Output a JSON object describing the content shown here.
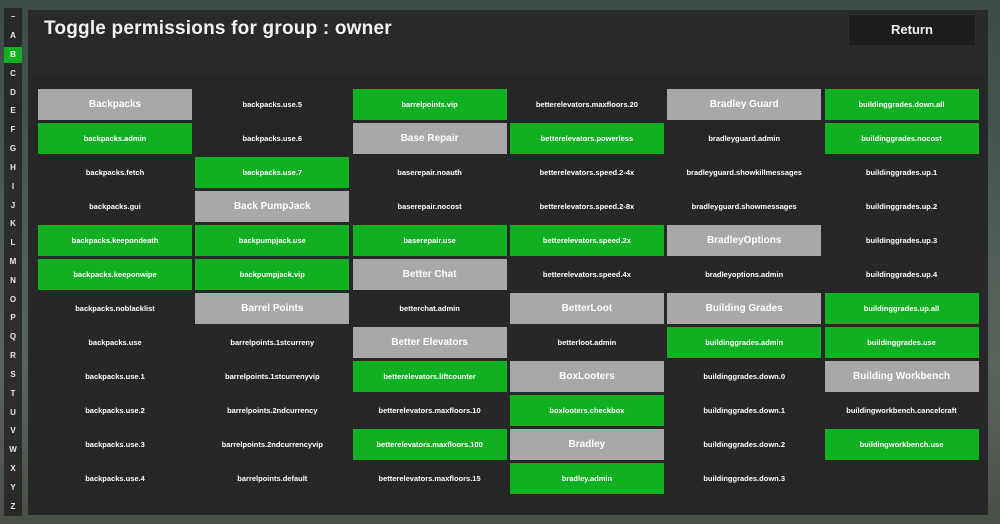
{
  "title": "Toggle permissions for group : owner",
  "return_label": "Return",
  "colors": {
    "on": "#11b022",
    "plugin_header": "#a8a8a8",
    "panel": "#222425"
  },
  "alphabet": {
    "letters": [
      "–",
      "A",
      "B",
      "C",
      "D",
      "E",
      "F",
      "G",
      "H",
      "I",
      "J",
      "K",
      "L",
      "M",
      "N",
      "O",
      "P",
      "Q",
      "R",
      "S",
      "T",
      "U",
      "V",
      "W",
      "X",
      "Y",
      "Z"
    ],
    "active": "B"
  },
  "columns": [
    [
      {
        "label": "Backpacks",
        "type": "plugin"
      },
      {
        "label": "backpacks.admin",
        "type": "on"
      },
      {
        "label": "backpacks.fetch",
        "type": "off"
      },
      {
        "label": "backpacks.gui",
        "type": "off"
      },
      {
        "label": "backpacks.keepondeath",
        "type": "on"
      },
      {
        "label": "backpacks.keeponwipe",
        "type": "on"
      },
      {
        "label": "backpacks.noblacklist",
        "type": "off"
      },
      {
        "label": "backpacks.use",
        "type": "off"
      },
      {
        "label": "backpacks.use.1",
        "type": "off"
      },
      {
        "label": "backpacks.use.2",
        "type": "off"
      },
      {
        "label": "backpacks.use.3",
        "type": "off"
      },
      {
        "label": "backpacks.use.4",
        "type": "off"
      }
    ],
    [
      {
        "label": "backpacks.use.5",
        "type": "off"
      },
      {
        "label": "backpacks.use.6",
        "type": "off"
      },
      {
        "label": "backpacks.use.7",
        "type": "on"
      },
      {
        "label": "Back PumpJack",
        "type": "plugin"
      },
      {
        "label": "backpumpjack.use",
        "type": "on"
      },
      {
        "label": "backpumpjack.vip",
        "type": "on"
      },
      {
        "label": "Barrel Points",
        "type": "plugin"
      },
      {
        "label": "barrelpoints.1stcurreny",
        "type": "off"
      },
      {
        "label": "barrelpoints.1stcurrenyvip",
        "type": "off"
      },
      {
        "label": "barrelpoints.2ndcurrency",
        "type": "off"
      },
      {
        "label": "barrelpoints.2ndcurrencyvip",
        "type": "off"
      },
      {
        "label": "barrelpoints.default",
        "type": "off"
      }
    ],
    [
      {
        "label": "barrelpoints.vip",
        "type": "on"
      },
      {
        "label": "Base Repair",
        "type": "plugin"
      },
      {
        "label": "baserepair.noauth",
        "type": "off"
      },
      {
        "label": "baserepair.nocost",
        "type": "off"
      },
      {
        "label": "baserepair.use",
        "type": "on"
      },
      {
        "label": "Better Chat",
        "type": "plugin"
      },
      {
        "label": "betterchat.admin",
        "type": "off"
      },
      {
        "label": "Better Elevators",
        "type": "plugin"
      },
      {
        "label": "betterelevators.liftcounter",
        "type": "on"
      },
      {
        "label": "betterelevators.maxfloors.10",
        "type": "off"
      },
      {
        "label": "betterelevators.maxfloors.100",
        "type": "on"
      },
      {
        "label": "betterelevators.maxfloors.15",
        "type": "off"
      }
    ],
    [
      {
        "label": "betterelevators.maxfloors.20",
        "type": "off"
      },
      {
        "label": "betterelevators.powerless",
        "type": "on"
      },
      {
        "label": "betterelevators.speed.2-4x",
        "type": "off"
      },
      {
        "label": "betterelevators.speed.2-8x",
        "type": "off"
      },
      {
        "label": "betterelevators.speed.2x",
        "type": "on"
      },
      {
        "label": "betterelevators.speed.4x",
        "type": "off"
      },
      {
        "label": "BetterLoot",
        "type": "plugin"
      },
      {
        "label": "betterloot.admin",
        "type": "off"
      },
      {
        "label": "BoxLooters",
        "type": "plugin"
      },
      {
        "label": "boxlooters.checkbox",
        "type": "on"
      },
      {
        "label": "Bradley",
        "type": "plugin"
      },
      {
        "label": "bradley.admin",
        "type": "on"
      }
    ],
    [
      {
        "label": "Bradley Guard",
        "type": "plugin"
      },
      {
        "label": "bradleyguard.admin",
        "type": "off"
      },
      {
        "label": "bradleyguard.showkillmessages",
        "type": "off"
      },
      {
        "label": "bradleyguard.showmessages",
        "type": "off"
      },
      {
        "label": "BradleyOptions",
        "type": "plugin"
      },
      {
        "label": "bradleyoptions.admin",
        "type": "off"
      },
      {
        "label": "Building Grades",
        "type": "plugin"
      },
      {
        "label": "buildinggrades.admin",
        "type": "on"
      },
      {
        "label": "buildinggrades.down.0",
        "type": "off"
      },
      {
        "label": "buildinggrades.down.1",
        "type": "off"
      },
      {
        "label": "buildinggrades.down.2",
        "type": "off"
      },
      {
        "label": "buildinggrades.down.3",
        "type": "off"
      }
    ],
    [
      {
        "label": "buildinggrades.down.all",
        "type": "on"
      },
      {
        "label": "buildinggrades.nocost",
        "type": "on"
      },
      {
        "label": "buildinggrades.up.1",
        "type": "off"
      },
      {
        "label": "buildinggrades.up.2",
        "type": "off"
      },
      {
        "label": "buildinggrades.up.3",
        "type": "off"
      },
      {
        "label": "buildinggrades.up.4",
        "type": "off"
      },
      {
        "label": "buildinggrades.up.all",
        "type": "on"
      },
      {
        "label": "buildinggrades.use",
        "type": "on"
      },
      {
        "label": "Building Workbench",
        "type": "plugin"
      },
      {
        "label": "buildingworkbench.cancelcraft",
        "type": "off"
      },
      {
        "label": "buildingworkbench.use",
        "type": "on"
      }
    ]
  ]
}
